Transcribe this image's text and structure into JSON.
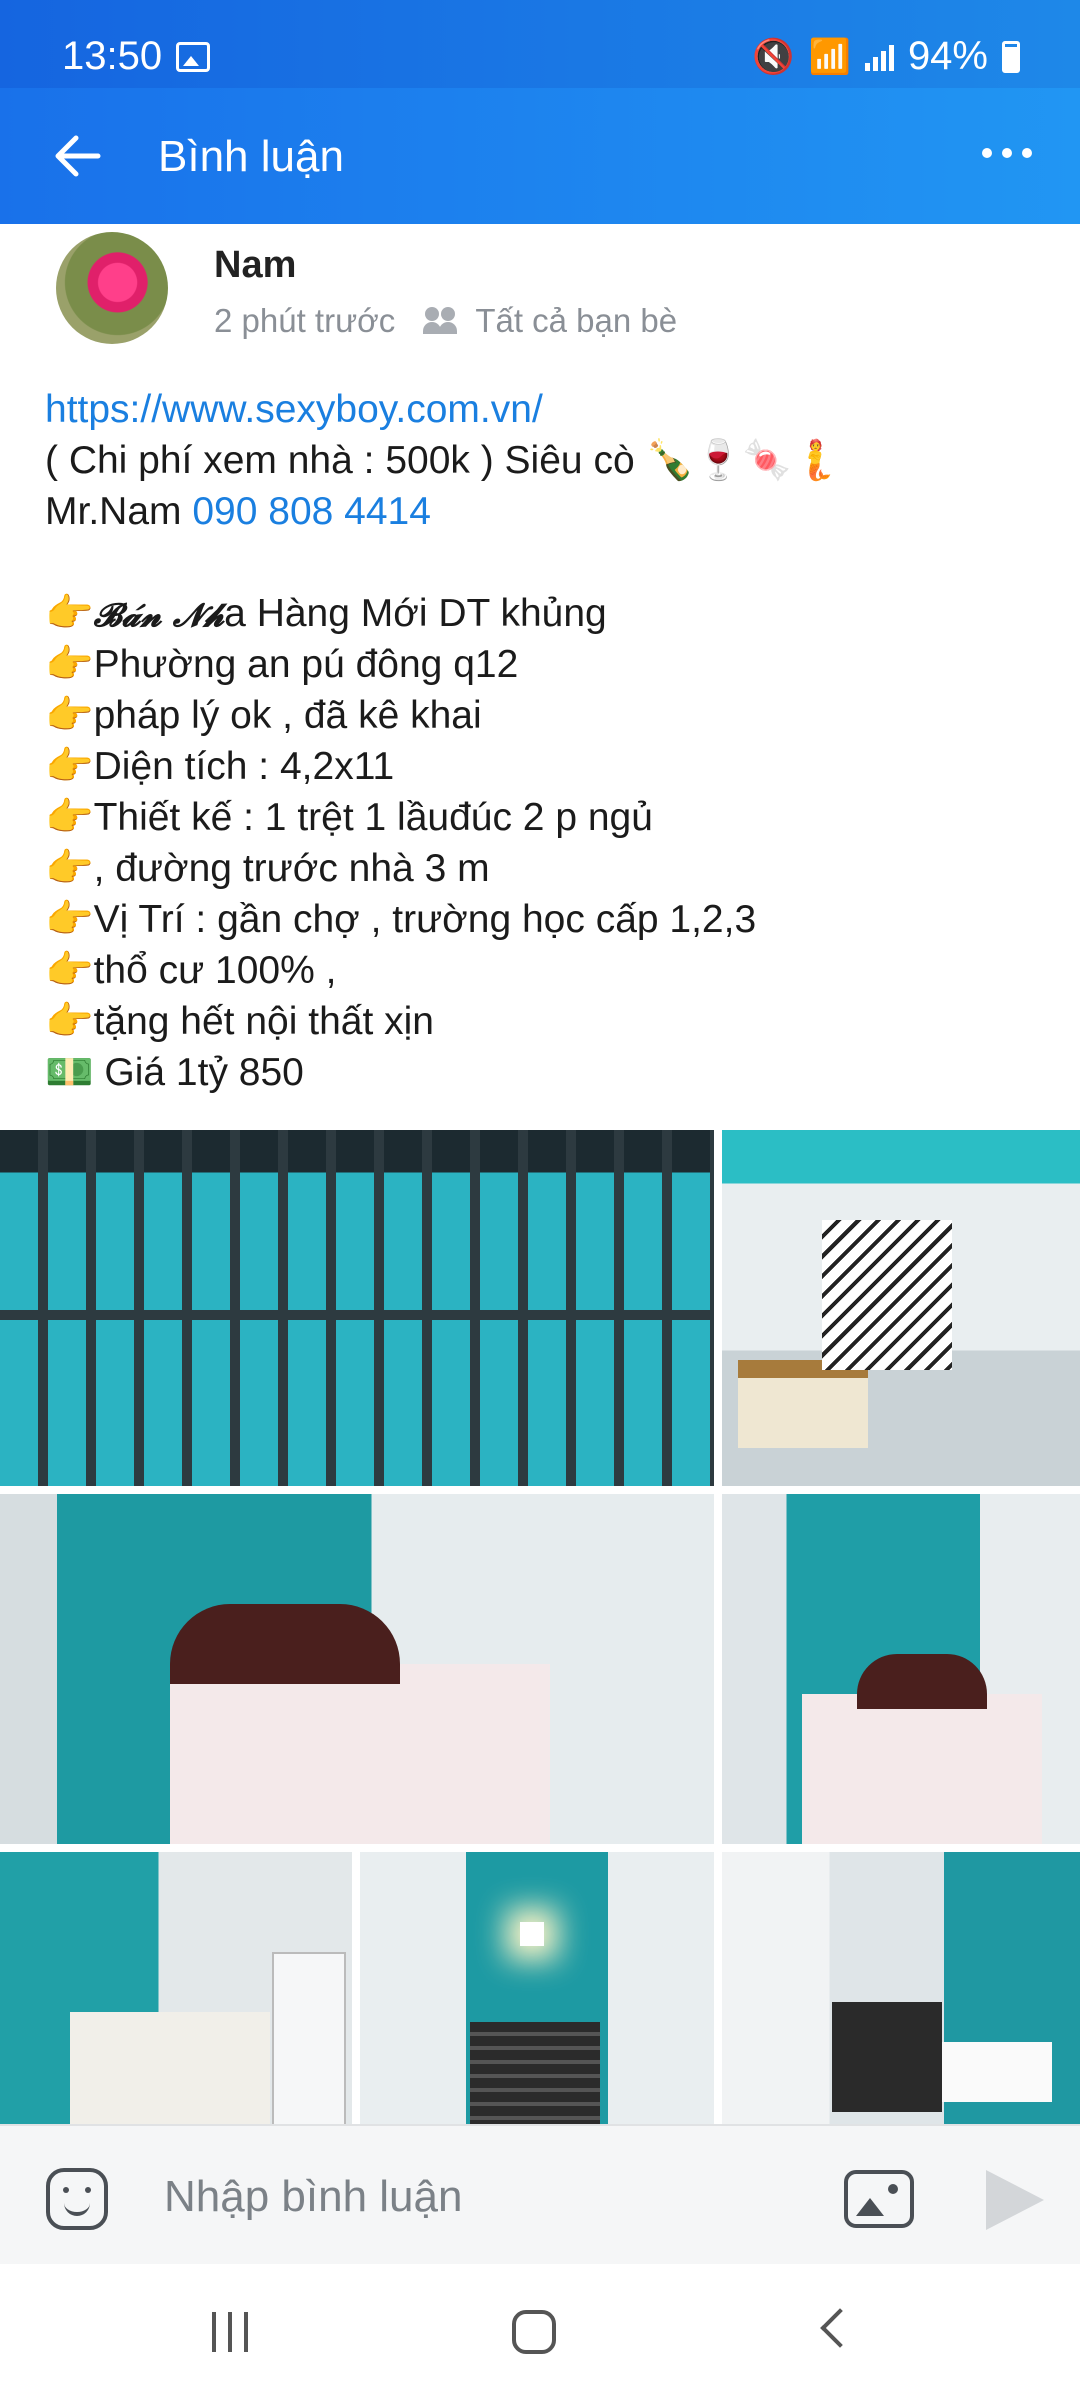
{
  "status_bar": {
    "time": "13:50",
    "battery": "94%",
    "icons": [
      "gallery-icon",
      "mute-icon",
      "wifi-icon",
      "signal-icon",
      "battery-icon"
    ]
  },
  "app_bar": {
    "title": "Bình luận",
    "back_icon": "arrow-left-icon",
    "more_icon": "more-horizontal-icon"
  },
  "post": {
    "author": "Nam",
    "time_ago": "2 phút trước",
    "audience": "Tất cả bạn bè",
    "link": "https://www.sexyboy.com.vn/",
    "line_fee": "( Chi phí xem nhà : 500k ) Siêu cò 🍾🍷🍬🧜",
    "contact_name": "Mr.Nam ",
    "contact_phone": "090 808 4414",
    "fancy_text": "𝓑𝓪́𝓷 𝓝𝓱",
    "bullets": [
      "a Hàng Mới DT khủng",
      "Phường an pú đông q12",
      "pháp lý ok , đã kê khai",
      "Diện tích : 4,2x11",
      "Thiết kế : 1 trệt 1 lầuđúc 2 p ngủ",
      ", đường trước nhà 3 m",
      "Vị Trí : gần chợ , trường học cấp 1,2,3",
      "thổ cư 100% ,",
      "tặng hết nội thất xịn"
    ],
    "bullet_emoji": "👉",
    "price_emoji": "💵",
    "price": " Giá 1tỷ 850",
    "photo_count": 7
  },
  "comment_bar": {
    "placeholder": "Nhập bình luận",
    "emoji_icon": "sticker-icon",
    "image_icon": "image-icon",
    "send_icon": "send-icon"
  },
  "nav_bar": {
    "icons": [
      "recent-apps-icon",
      "home-icon",
      "back-icon"
    ]
  }
}
